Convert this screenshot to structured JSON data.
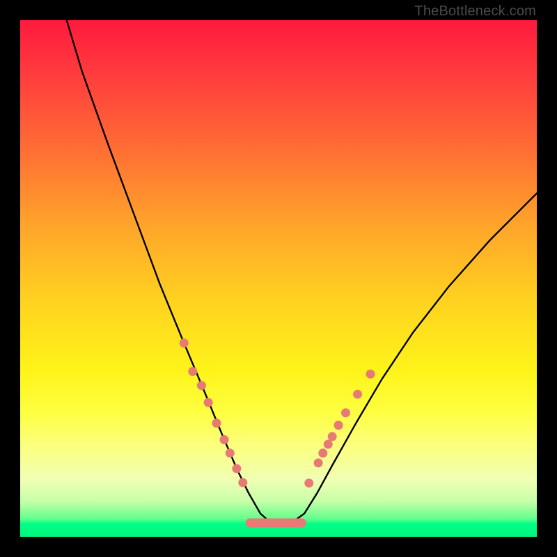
{
  "watermark": "TheBottleneck.com",
  "colors": {
    "frame": "#000000",
    "curve_stroke": "#000000",
    "marker_fill": "#e77a74",
    "gradient_top": "#ff1a3e",
    "gradient_mid": "#ffd41f",
    "gradient_bottom": "#00f57d"
  },
  "chart_data": {
    "type": "line",
    "title": "",
    "xlabel": "",
    "ylabel": "",
    "xlim": [
      0,
      100
    ],
    "ylim": [
      0,
      100
    ],
    "note": "Axes are unlabeled in the source image; x is an implicit horizontal parameter (0–100 normalized), y is bottleneck severity (0 = none/green, 100 = severe/red). Values are read from pixel positions relative to the 742×742 plot area.",
    "series": [
      {
        "name": "bottleneck-curve",
        "x": [
          9.0,
          12.0,
          17.0,
          22.0,
          27.0,
          31.5,
          35.5,
          39.0,
          42.0,
          44.2,
          46.5,
          48.5,
          52.5,
          55.0,
          57.5,
          60.5,
          65.0,
          70.0,
          76.0,
          83.0,
          91.0,
          100.0
        ],
        "y": [
          100.0,
          90.0,
          76.0,
          62.5,
          49.0,
          38.0,
          28.5,
          20.0,
          13.0,
          8.5,
          4.5,
          2.7,
          2.7,
          4.5,
          8.5,
          14.0,
          22.0,
          30.5,
          39.5,
          48.5,
          57.5,
          66.5
        ]
      }
    ],
    "markers": {
      "name": "highlighted-points",
      "note": "Salmon-colored sample dots along the curve near the valley.",
      "points": [
        {
          "x": 31.7,
          "y": 37.5
        },
        {
          "x": 33.4,
          "y": 32.0
        },
        {
          "x": 35.1,
          "y": 29.3
        },
        {
          "x": 36.4,
          "y": 26.0
        },
        {
          "x": 38.0,
          "y": 22.0
        },
        {
          "x": 39.5,
          "y": 18.8
        },
        {
          "x": 40.6,
          "y": 16.2
        },
        {
          "x": 41.9,
          "y": 13.2
        },
        {
          "x": 43.1,
          "y": 10.5
        },
        {
          "x": 55.9,
          "y": 10.4
        },
        {
          "x": 57.7,
          "y": 14.3
        },
        {
          "x": 58.6,
          "y": 16.2
        },
        {
          "x": 59.6,
          "y": 17.9
        },
        {
          "x": 60.4,
          "y": 19.4
        },
        {
          "x": 61.6,
          "y": 21.6
        },
        {
          "x": 63.0,
          "y": 24.0
        },
        {
          "x": 65.3,
          "y": 27.6
        },
        {
          "x": 67.8,
          "y": 31.5
        }
      ]
    },
    "valley_segment": {
      "name": "optimal-range-bar",
      "note": "Thick salmon horizontal segment at the curve minimum.",
      "x_start": 44.5,
      "x_end": 54.5,
      "y": 2.7
    }
  }
}
